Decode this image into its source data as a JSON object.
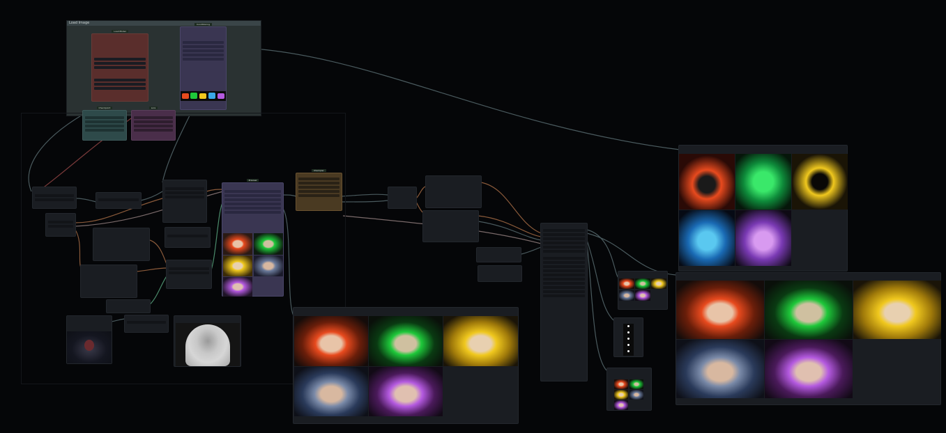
{
  "canvas": {
    "background": "#050608",
    "group_title": "Load Image"
  },
  "nodes": {
    "load_model_title": "Load Model",
    "concat_title": "Conditioning",
    "checkpoint_title": "Checkpoint",
    "lora_title": "Lora",
    "sampler_title": "KSampler",
    "preview_title": "Preview"
  },
  "colors": {
    "wire_gray": "#4a5a5e",
    "wire_orange": "#8a5a3a",
    "wire_green": "#4a8a6a",
    "node_red": "#5a2e2c",
    "node_purple": "#3a3652",
    "node_teal": "#2e4a4a",
    "node_violet": "#4a2e4a",
    "node_brown": "#4a3a22",
    "accent_red": "#e84a1e",
    "accent_green": "#1ec83a",
    "accent_yellow": "#f0c81e",
    "accent_blue": "#3aa8e8",
    "accent_purple": "#b45ae0"
  },
  "gallery": {
    "hood_colors": [
      "orange",
      "green",
      "yellow",
      "blue",
      "purple"
    ]
  }
}
